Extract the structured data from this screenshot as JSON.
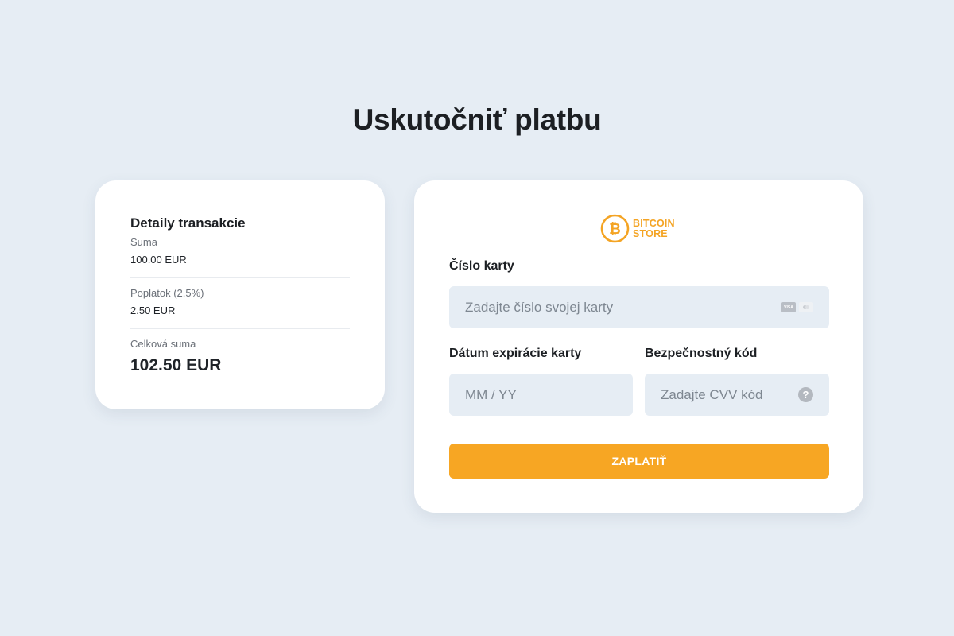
{
  "page": {
    "title": "Uskutočniť platbu"
  },
  "summary": {
    "heading": "Detaily transakcie",
    "rows": [
      {
        "label": "Suma",
        "value": "100.00 EUR"
      },
      {
        "label": "Poplatok (2.5%)",
        "value": "2.50 EUR"
      },
      {
        "label": "Celková suma",
        "value": "102.50 EUR"
      }
    ]
  },
  "payment": {
    "brand": {
      "line1": "BITCOIN",
      "line2": "STORE",
      "icon": "bitcoin-icon",
      "color": "#f4a424"
    },
    "card_number": {
      "label": "Číslo karty",
      "placeholder": "Zadajte číslo svojej karty",
      "icons": [
        "visa-icon",
        "mastercard-icon"
      ],
      "visa_text": "VISA"
    },
    "expiry": {
      "label": "Dátum expirácie karty",
      "placeholder": "MM / YY"
    },
    "cvv": {
      "label": "Bezpečnostný kód",
      "placeholder": "Zadajte CVV kód",
      "help_icon": "question-icon",
      "help_text": "?"
    },
    "submit_label": "ZAPLATIŤ",
    "accent_color": "#f7a623"
  }
}
